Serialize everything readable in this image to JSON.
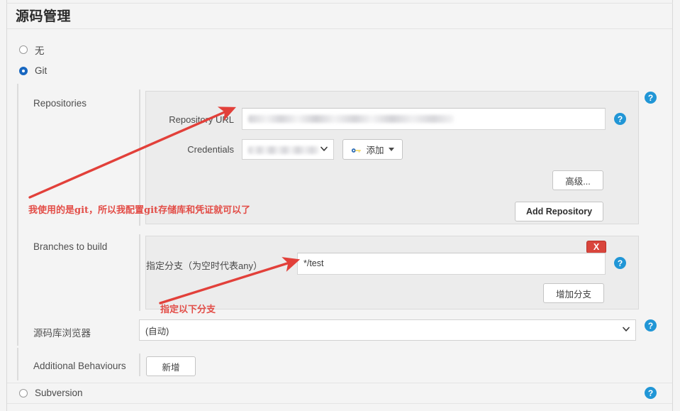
{
  "page": {
    "title": "源码管理",
    "accent_blue": "#1867c0",
    "help_icon_color": "#2196d6",
    "annotation_red": "#e2403a",
    "delete_red": "#d9453c",
    "panel_bg": "#ececec",
    "page_bg": "#f4f4f4"
  },
  "scm_options": [
    {
      "label": "无",
      "checked": false
    },
    {
      "label": "Git",
      "checked": true
    },
    {
      "label": "Subversion",
      "checked": false
    }
  ],
  "git": {
    "repositories": {
      "section_label": "Repositories",
      "url_label": "Repository URL",
      "url_value": "",
      "url_redacted": true,
      "credentials_label": "Credentials",
      "credentials_value": "",
      "credentials_redacted": true,
      "add_credentials_button": "添加",
      "add_credentials_icon": "key-icon",
      "advanced_button": "高级...",
      "add_repository_button": "Add Repository"
    },
    "branches": {
      "section_label": "Branches to build",
      "branch_label": "指定分支（为空时代表any）",
      "branch_value": "*/test",
      "delete_button": "X",
      "add_branch_button": "增加分支"
    },
    "browser": {
      "section_label": "源码库浏览器",
      "selected_option": "(自动)"
    },
    "additional_behaviours": {
      "section_label": "Additional Behaviours",
      "add_button": "新增"
    }
  },
  "annotations": [
    {
      "text": "我使用的是git，所以我配置git存储库和凭证就可以了"
    },
    {
      "text": "指定以下分支"
    }
  ],
  "icons": {
    "help": "?",
    "chevron_down": "chevron-down-icon",
    "caret_down": "caret-down-icon"
  }
}
